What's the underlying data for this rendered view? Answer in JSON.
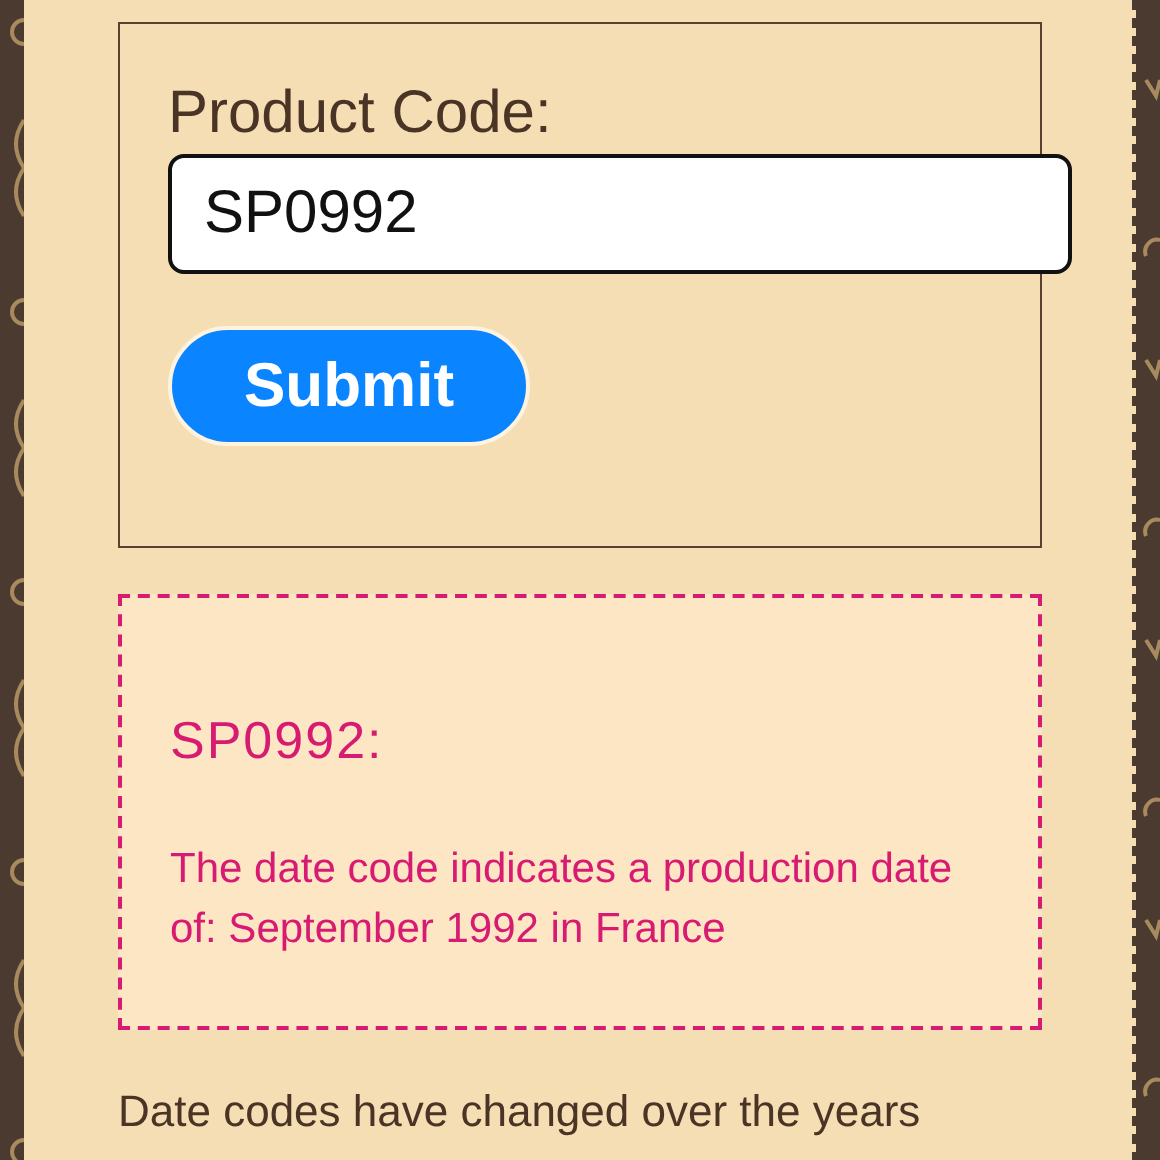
{
  "form": {
    "label": "Product Code:",
    "value": "SP0992",
    "button": "Submit"
  },
  "result": {
    "code": "SP0992:",
    "message": "The date code indicates a production date of: September 1992 in France"
  },
  "info": "Date codes have changed over the years"
}
